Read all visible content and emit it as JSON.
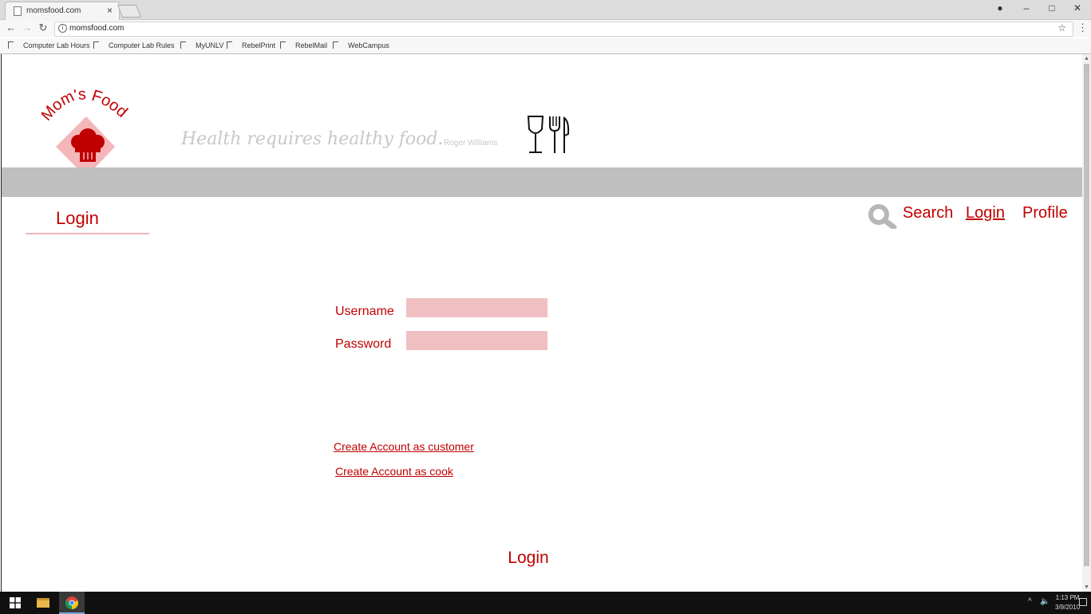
{
  "browser": {
    "tab_title": "momsfood.com",
    "tab_close": "×",
    "url": "momsfood.com",
    "window_controls": {
      "minimize": "–",
      "maximize": "□",
      "close": "✕",
      "account": "●"
    },
    "nav": {
      "back": "←",
      "forward": "→",
      "reload": "↻",
      "info": "i",
      "star": "☆",
      "menu": "⋮"
    },
    "bookmarks": [
      "Computer Lab Hours",
      "Computer Lab Rules",
      "MyUNLV",
      "RebelPrint",
      "RebelMail",
      "WebCampus"
    ]
  },
  "site": {
    "logo_text": "Mom's Food",
    "tagline": "Health requires healthy food.",
    "quote_author": "- Roger Williams",
    "colors": {
      "brand": "#c00000",
      "field_bg": "#f0bfc2",
      "band": "#bfbfbf",
      "logo_diamond": "#f4b6b9"
    }
  },
  "nav": {
    "search": "Search",
    "login": "Login",
    "profile": "Profile"
  },
  "page": {
    "heading": "Login"
  },
  "form": {
    "username_label": "Username",
    "username_value": "",
    "password_label": "Password",
    "password_value": "",
    "create_customer": "Create Account as customer",
    "create_cook": "Create Account as cook",
    "submit": "Login"
  },
  "taskbar": {
    "time": "1:13 PM",
    "date": "3/9/2010",
    "tray_chevron": "^",
    "tray_volume": "🔈"
  }
}
